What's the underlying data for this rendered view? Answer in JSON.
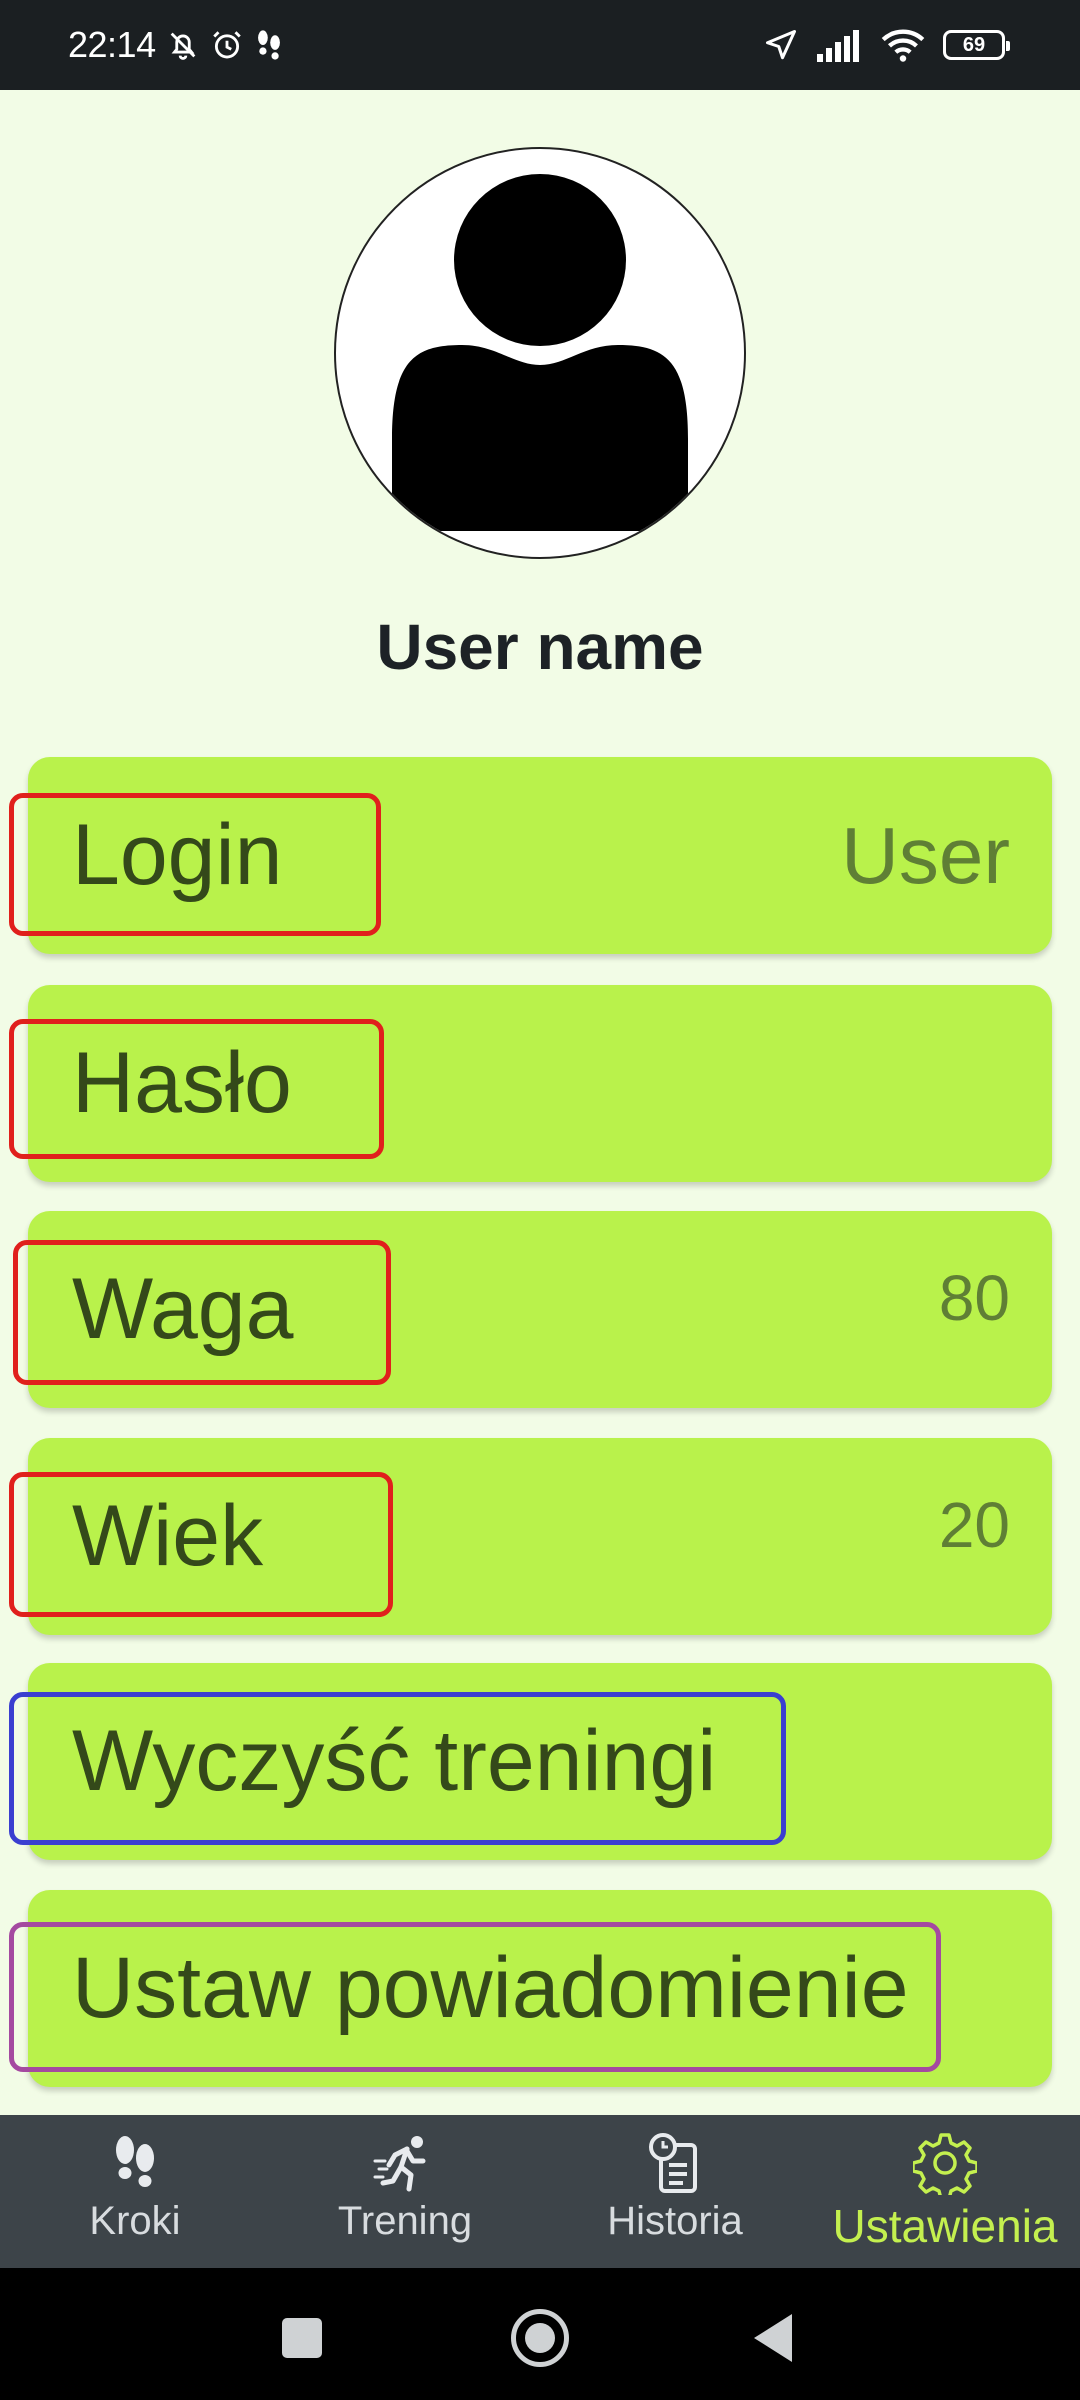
{
  "status_bar": {
    "time": "22:14",
    "left_icons": [
      "mute-bell-icon",
      "alarm-icon",
      "footsteps-icon"
    ],
    "right_icons": [
      "location-arrow-icon",
      "signal-icon",
      "wifi-icon",
      "battery-icon"
    ],
    "battery": "69"
  },
  "profile": {
    "avatar_icon": "user-avatar-icon",
    "username": "User name"
  },
  "settings": {
    "login": {
      "label": "Login",
      "value": "User"
    },
    "password": {
      "label": "Hasło",
      "value": ""
    },
    "weight": {
      "label": "Waga",
      "value": "80"
    },
    "age": {
      "label": "Wiek",
      "value": "20"
    },
    "clear_workouts": {
      "label": "Wyczyść treningi"
    },
    "set_notification": {
      "label": "Ustaw powiadomienie"
    }
  },
  "bottom_nav": {
    "items": [
      {
        "label": "Kroki",
        "icon": "footsteps-icon"
      },
      {
        "label": "Trening",
        "icon": "runner-icon"
      },
      {
        "label": "Historia",
        "icon": "history-clipboard-icon"
      },
      {
        "label": "Ustawienia",
        "icon": "gear-icon",
        "active": true
      }
    ]
  },
  "colors": {
    "background": "#f2fce6",
    "row_fill": "#b9f24b",
    "nav_background": "#3d4449",
    "nav_active": "#c4f04f",
    "highlight_red": "#e0201c",
    "highlight_blue": "#3a3fd0",
    "highlight_purple": "#a44aa0"
  }
}
